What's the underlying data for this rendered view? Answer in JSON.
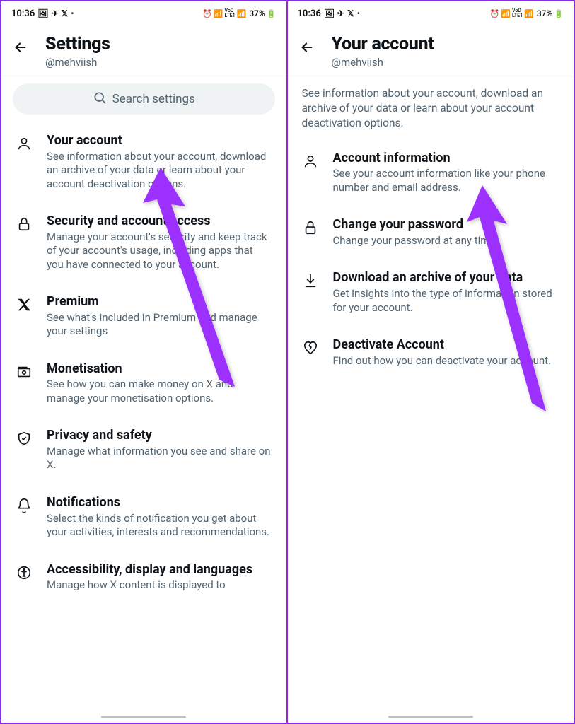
{
  "status": {
    "time": "10:36",
    "battery": "37%"
  },
  "left": {
    "title": "Settings",
    "handle": "@mehviish",
    "search_placeholder": "Search settings",
    "items": [
      {
        "title": "Your account",
        "desc": "See information about your account, download an archive of your data or learn about your account deactivation options."
      },
      {
        "title": "Security and account access",
        "desc": "Manage your account's security and keep track of your account's usage, including apps that you have connected to your account."
      },
      {
        "title": "Premium",
        "desc": "See what's included in Premium and manage your settings"
      },
      {
        "title": "Monetisation",
        "desc": "See how you can make money on X and manage your monetisation options."
      },
      {
        "title": "Privacy and safety",
        "desc": "Manage what information you see and share on X."
      },
      {
        "title": "Notifications",
        "desc": "Select the kinds of notification you get about your activities, interests and recommendations."
      },
      {
        "title": "Accessibility, display and languages",
        "desc": "Manage how X content is displayed to"
      }
    ]
  },
  "right": {
    "title": "Your account",
    "handle": "@mehviish",
    "intro": "See information about your account, download an archive of your data or learn about your account deactivation options.",
    "items": [
      {
        "title": "Account information",
        "desc": "See your account information like your phone number and email address."
      },
      {
        "title": "Change your password",
        "desc": "Change your password at any time."
      },
      {
        "title": "Download an archive of your data",
        "desc": "Get insights into the type of information stored for your account."
      },
      {
        "title": "Deactivate Account",
        "desc": "Find out how you can deactivate your account."
      }
    ]
  }
}
